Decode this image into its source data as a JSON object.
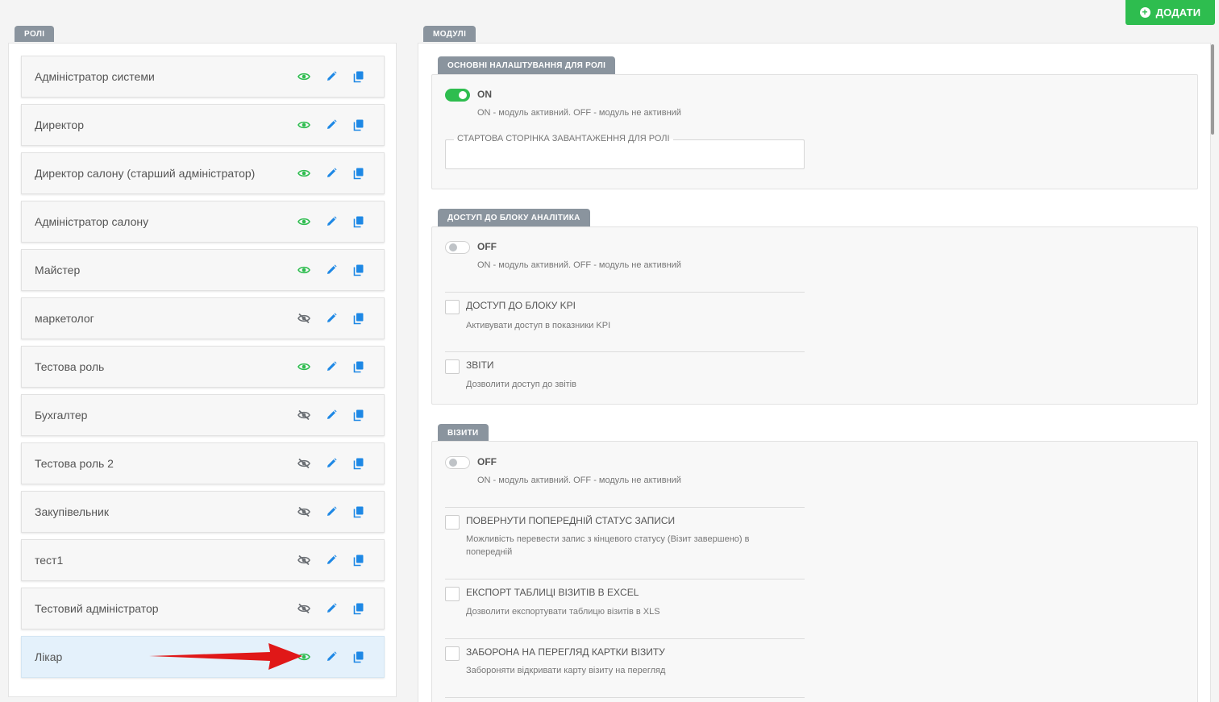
{
  "header": {
    "add_label": "ДОДАТИ"
  },
  "roles_panel": {
    "tab": "РОЛІ",
    "items": [
      {
        "name": "Адміністратор системи",
        "visible": true
      },
      {
        "name": "Директор",
        "visible": true
      },
      {
        "name": "Директор салону (старший адміністратор)",
        "visible": true
      },
      {
        "name": "Адміністратор салону",
        "visible": true
      },
      {
        "name": "Майстер",
        "visible": true
      },
      {
        "name": "маркетолог",
        "visible": false
      },
      {
        "name": "Тестова роль",
        "visible": true
      },
      {
        "name": "Бухгалтер",
        "visible": false
      },
      {
        "name": "Тестова роль 2",
        "visible": false
      },
      {
        "name": "Закупівельник",
        "visible": false
      },
      {
        "name": "тест1",
        "visible": false
      },
      {
        "name": "Тестовий адміністратор",
        "visible": false
      },
      {
        "name": "Лікар",
        "visible": true,
        "selected": true
      }
    ]
  },
  "modules_panel": {
    "tab": "МОДУЛІ",
    "sections": {
      "basic": {
        "title": "ОСНОВНІ НАЛАШТУВАННЯ ДЛЯ РОЛІ",
        "toggle": "ON",
        "hint": "ON - модуль активний. OFF - модуль не активний",
        "start_page_label": "СТАРТОВА СТОРІНКА ЗАВАНТАЖЕННЯ ДЛЯ РОЛІ",
        "start_page_value": ""
      },
      "analytics": {
        "title": "ДОСТУП ДО БЛОКУ АНАЛІТИКА",
        "toggle": "OFF",
        "hint": "ON - модуль активний. OFF - модуль не активний",
        "options": [
          {
            "title": "ДОСТУП ДО БЛОКУ KPI",
            "desc": "Активувати доступ в показники KPI"
          },
          {
            "title": "ЗВІТИ",
            "desc": "Дозволити доступ до звітів"
          }
        ]
      },
      "visits": {
        "title": "ВІЗИТИ",
        "toggle": "OFF",
        "hint": "ON - модуль активний. OFF - модуль не активний",
        "options": [
          {
            "title": "ПОВЕРНУТИ ПОПЕРЕДНІЙ СТАТУС ЗАПИСИ",
            "desc": "Можливість перевести запис з кінцевого статусу (Візит завершено) в попередній"
          },
          {
            "title": "ЕКСПОРТ ТАБЛИЦІ ВІЗИТІВ В EXCEL",
            "desc": "Дозволити експортувати таблицю візитів в XLS"
          },
          {
            "title": "ЗАБОРОНА НА ПЕРЕГЛЯД КАРТКИ ВІЗИТУ",
            "desc": "Забороняти відкривати карту візиту на перегляд"
          }
        ]
      }
    }
  },
  "colors": {
    "accent_green": "#2ebd4f",
    "icon_blue": "#1e88e5",
    "eye_visible": "#2ebd4f",
    "eye_hidden": "#6b6f74",
    "annotation_arrow": "#e01818"
  },
  "icons": {
    "visible": "eye-icon",
    "hidden": "eye-slash-icon",
    "edit": "pencil-icon",
    "copy": "copy-icon"
  }
}
